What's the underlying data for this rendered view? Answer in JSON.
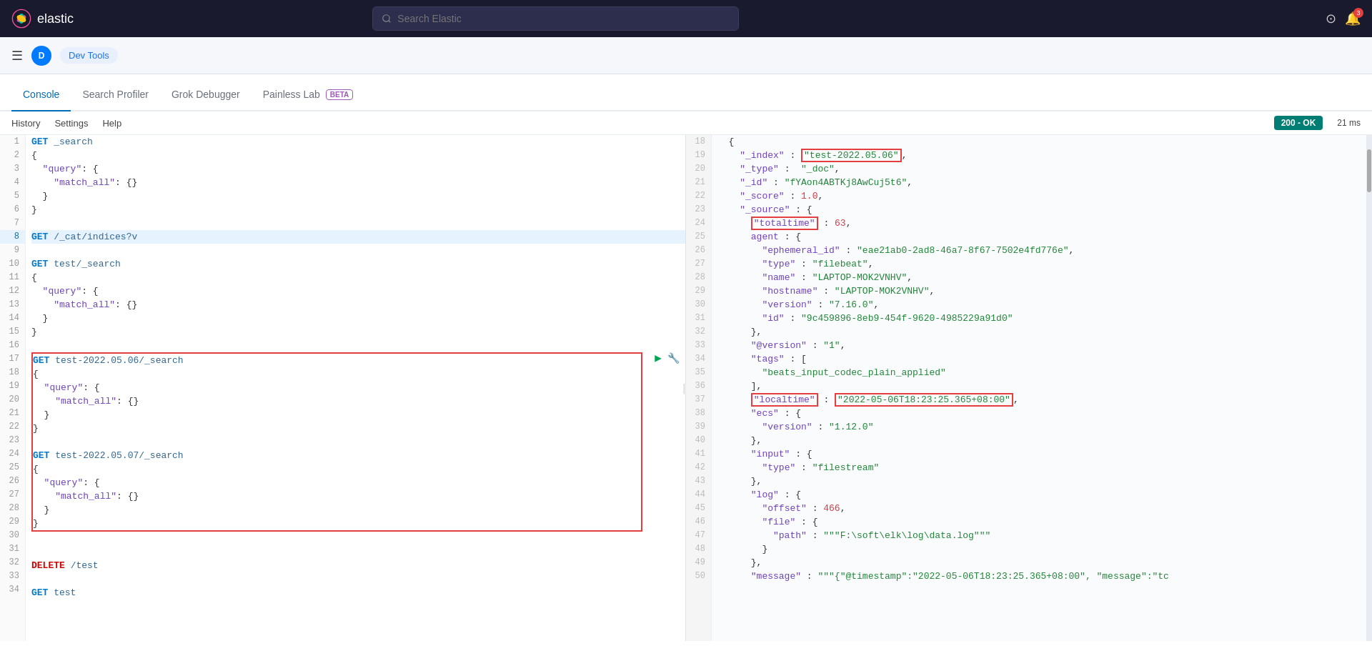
{
  "topbar": {
    "logo_text": "elastic",
    "search_placeholder": "Search Elastic",
    "user_initial": "D"
  },
  "second_bar": {
    "app_name": "Dev Tools"
  },
  "tabs": [
    {
      "id": "console",
      "label": "Console",
      "active": true,
      "beta": false
    },
    {
      "id": "search-profiler",
      "label": "Search Profiler",
      "active": false,
      "beta": false
    },
    {
      "id": "grok-debugger",
      "label": "Grok Debugger",
      "active": false,
      "beta": false
    },
    {
      "id": "painless-lab",
      "label": "Painless Lab",
      "active": false,
      "beta": true
    }
  ],
  "menu": {
    "items": [
      "History",
      "Settings",
      "Help"
    ]
  },
  "status": {
    "code": "200 - OK",
    "time": "21 ms"
  },
  "editor": {
    "lines": [
      {
        "num": "1",
        "content": "GET _search",
        "active": false
      },
      {
        "num": "2",
        "content": "{",
        "active": false
      },
      {
        "num": "3",
        "content": "  \"query\": {",
        "active": false
      },
      {
        "num": "4",
        "content": "    \"match_all\": {}",
        "active": false
      },
      {
        "num": "5",
        "content": "  }",
        "active": false
      },
      {
        "num": "6",
        "content": "}",
        "active": false
      },
      {
        "num": "7",
        "content": "",
        "active": false
      },
      {
        "num": "8",
        "content": "GET /_cat/indices?v",
        "active": true
      },
      {
        "num": "9",
        "content": "",
        "active": false
      },
      {
        "num": "10",
        "content": "GET test/_search",
        "active": false
      },
      {
        "num": "11",
        "content": "{",
        "active": false
      },
      {
        "num": "12",
        "content": "  \"query\": {",
        "active": false
      },
      {
        "num": "13",
        "content": "    \"match_all\": {}",
        "active": false
      },
      {
        "num": "14",
        "content": "  }",
        "active": false
      },
      {
        "num": "15",
        "content": "}",
        "active": false
      },
      {
        "num": "16",
        "content": "",
        "active": false
      },
      {
        "num": "17",
        "content": "GET test-2022.05.06/_search",
        "active": false
      },
      {
        "num": "18",
        "content": "{",
        "active": false
      },
      {
        "num": "19",
        "content": "  \"query\": {",
        "active": false
      },
      {
        "num": "20",
        "content": "    \"match_all\": {}",
        "active": false
      },
      {
        "num": "21",
        "content": "  }",
        "active": false
      },
      {
        "num": "22",
        "content": "}",
        "active": false
      },
      {
        "num": "23",
        "content": "",
        "active": false
      },
      {
        "num": "24",
        "content": "GET test-2022.05.07/_search",
        "active": false
      },
      {
        "num": "25",
        "content": "{",
        "active": false
      },
      {
        "num": "26",
        "content": "  \"query\": {",
        "active": false
      },
      {
        "num": "27",
        "content": "    \"match_all\": {}",
        "active": false
      },
      {
        "num": "28",
        "content": "  }",
        "active": false
      },
      {
        "num": "29",
        "content": "}",
        "active": false
      },
      {
        "num": "30",
        "content": "",
        "active": false
      },
      {
        "num": "31",
        "content": "",
        "active": false
      },
      {
        "num": "32",
        "content": "DELETE /test",
        "active": false
      },
      {
        "num": "33",
        "content": "",
        "active": false
      },
      {
        "num": "34",
        "content": "GET test",
        "active": false
      }
    ]
  },
  "output": {
    "lines": [
      {
        "num": "18",
        "content": "  {"
      },
      {
        "num": "19",
        "content": "    \"_index\" : \"test-2022.05.06\","
      },
      {
        "num": "20",
        "content": "    \"_type\" :  \"_doc\","
      },
      {
        "num": "21",
        "content": "    \"_id\" : \"fYAon4ABTKj8AwCuj5t6\","
      },
      {
        "num": "22",
        "content": "    \"_score\" : 1.0,"
      },
      {
        "num": "23",
        "content": "    \"_source\" : {"
      },
      {
        "num": "24",
        "content": "      \"totaltime\" : 63,"
      },
      {
        "num": "25",
        "content": "      agent : {"
      },
      {
        "num": "26",
        "content": "        \"ephemeral_id\" : \"eae21ab0-2ad8-46a7-8f67-7502e4fd776e\","
      },
      {
        "num": "27",
        "content": "        \"type\" : \"filebeat\","
      },
      {
        "num": "28",
        "content": "        \"name\" : \"LAPTOP-MOK2VNHV\","
      },
      {
        "num": "29",
        "content": "        \"hostname\" : \"LAPTOP-MOK2VNHV\","
      },
      {
        "num": "30",
        "content": "        \"version\" : \"7.16.0\","
      },
      {
        "num": "31",
        "content": "        \"id\" : \"9c459896-8eb9-454f-9620-4985229a91d0\""
      },
      {
        "num": "32",
        "content": "      },"
      },
      {
        "num": "33",
        "content": "      \"@version\" : \"1\","
      },
      {
        "num": "34",
        "content": "      \"tags\" : ["
      },
      {
        "num": "35",
        "content": "        \"beats_input_codec_plain_applied\""
      },
      {
        "num": "36",
        "content": "      ],"
      },
      {
        "num": "37",
        "content": "      \"localtime\" : \"2022-05-06T18:23:25.365+08:00\","
      },
      {
        "num": "38",
        "content": "      \"ecs\" : {"
      },
      {
        "num": "39",
        "content": "        \"version\" : \"1.12.0\""
      },
      {
        "num": "40",
        "content": "      },"
      },
      {
        "num": "41",
        "content": "      \"input\" : {"
      },
      {
        "num": "42",
        "content": "        \"type\" : \"filestream\""
      },
      {
        "num": "43",
        "content": "      },"
      },
      {
        "num": "44",
        "content": "      \"log\" : {"
      },
      {
        "num": "45",
        "content": "        \"offset\" : 466,"
      },
      {
        "num": "46",
        "content": "        \"file\" : {"
      },
      {
        "num": "47",
        "content": "          \"path\" : \"\"\"F:\\soft\\elk\\log\\data.log\"\"\""
      },
      {
        "num": "48",
        "content": "        }"
      },
      {
        "num": "49",
        "content": "      },"
      },
      {
        "num": "50",
        "content": "      \"message\" : \"\"\"{\"@timestamp\":\"2022-05-06T18:23:25.365+08:00\", \"message\":\"tc"
      }
    ]
  }
}
